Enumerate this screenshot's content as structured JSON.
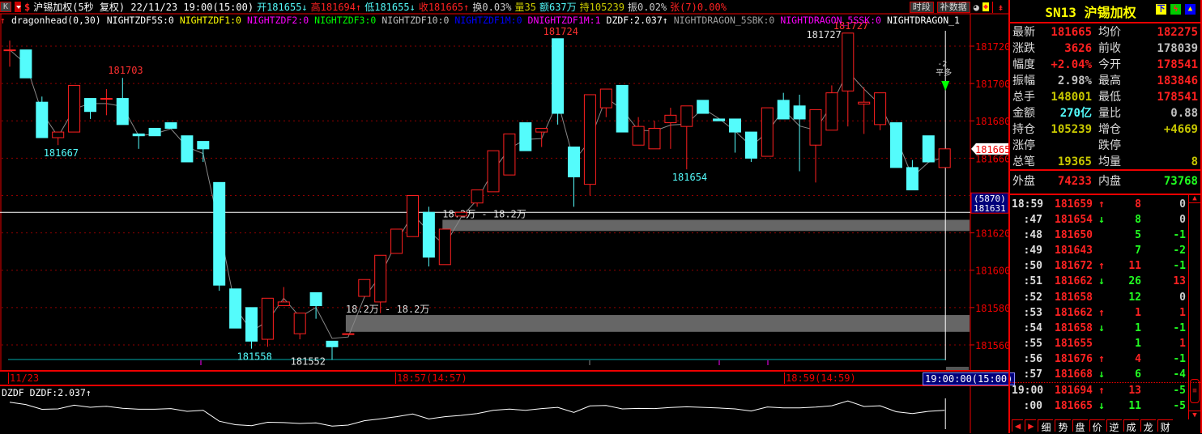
{
  "header": {
    "k_button": "K",
    "symbol_desc": "沪锡加权(5秒 复权) 22/11/23 19:00(15:00)",
    "open": "开181655↓",
    "high": "高181694↑",
    "low": "低181655↓",
    "close": "收181665↑",
    "turnover": "换0.03%",
    "volume": "量35",
    "amount": "额637万",
    "position": "持105239",
    "amplitude": "振0.02%",
    "limit": "张(7)0.00%",
    "period_button": "时段",
    "fill_data_button": "补数据"
  },
  "indicators": [
    {
      "text": "dragonhead(0,30)",
      "color": "#ffffff"
    },
    {
      "text": "NIGHTZDF5S:0",
      "color": "#ffffff"
    },
    {
      "text": "NIGHTZDF1:0",
      "color": "#ffff00"
    },
    {
      "text": "NIGHTZDF2:0",
      "color": "#ff00ff"
    },
    {
      "text": "NIGHTZDF3:0",
      "color": "#00ff00"
    },
    {
      "text": "NIGHTZDF10:0",
      "color": "#c0c0c0"
    },
    {
      "text": "NIGHTZDF1M:0",
      "color": "#0000ff"
    },
    {
      "text": "DNIGHTZDF1M:1",
      "color": "#ff00ff"
    },
    {
      "text": "DZDF:2.037↑",
      "color": "#ffffff"
    },
    {
      "text": "NIGHTDRAGON_5SBK:0",
      "color": "#a0a0a0"
    },
    {
      "text": "NIGHTDRAGON_5SSK:0",
      "color": "#ff00ff"
    },
    {
      "text": "NIGHTDRAGON_1",
      "color": "#ffffff"
    }
  ],
  "chart_data": {
    "type": "candlestick",
    "ylim": [
      181552,
      181727
    ],
    "y_ticks": [
      181720,
      181700,
      181680,
      181660,
      181620,
      181600,
      181580,
      181560
    ],
    "prev_close": 178039,
    "candles": [
      [
        181718,
        181723,
        181709,
        181718
      ],
      [
        181718,
        181718,
        181703,
        181703
      ],
      [
        181690,
        181693,
        181671,
        181671
      ],
      [
        181671,
        181674,
        181667,
        181674
      ],
      [
        181674,
        181699,
        181674,
        181699
      ],
      [
        181692,
        181692,
        181681,
        181685
      ],
      [
        181692,
        181697,
        181683,
        181692
      ],
      [
        181692,
        181703,
        181678,
        181678
      ],
      [
        181673,
        181673,
        181665,
        181672
      ],
      [
        181676,
        181676,
        181672,
        181672
      ],
      [
        181679,
        181679,
        181676,
        181676
      ],
      [
        181672,
        181672,
        181658,
        181658
      ],
      [
        181669,
        181669,
        181658,
        181665
      ],
      [
        181647,
        181647,
        181589,
        181592
      ],
      [
        181590,
        181590,
        181569,
        181569
      ],
      [
        181580,
        181580,
        181558,
        181562
      ],
      [
        181563,
        181585,
        181559,
        181585
      ],
      [
        181581,
        181591,
        181581,
        181583
      ],
      [
        181566,
        181577,
        181563,
        181577
      ],
      [
        181588,
        181588,
        181574,
        181581
      ],
      [
        181562,
        181562,
        181552,
        181559
      ],
      [
        181566,
        181566,
        181566,
        181566
      ],
      [
        181586,
        181595,
        181586,
        181595
      ],
      [
        181583,
        181608,
        181577,
        181608
      ],
      [
        181609,
        181622,
        181609,
        181622
      ],
      [
        181618,
        181640,
        181618,
        181640
      ],
      [
        181631,
        181634,
        181602,
        181607
      ],
      [
        181603,
        181622,
        181603,
        181622
      ],
      [
        181629,
        181631,
        181629,
        181631
      ],
      [
        181636,
        181643,
        181634,
        181643
      ],
      [
        181642,
        181664,
        181642,
        181664
      ],
      [
        181651,
        181673,
        181651,
        181673
      ],
      [
        181679,
        181679,
        181664,
        181664
      ],
      [
        181674,
        181676,
        181666,
        181676
      ],
      [
        181724,
        181724,
        181678,
        181684
      ],
      [
        181666,
        181666,
        181634,
        181650
      ],
      [
        181646,
        181694,
        181640,
        181694
      ],
      [
        181687,
        181697,
        181682,
        181697
      ],
      [
        181699,
        181699,
        181674,
        181674
      ],
      [
        181667,
        181682,
        181667,
        181677
      ],
      [
        181665,
        181680,
        181665,
        181676
      ],
      [
        181679,
        181687,
        181665,
        181683
      ],
      [
        181677,
        181688,
        181654,
        181688
      ],
      [
        181691,
        181691,
        181684,
        181684
      ],
      [
        181681,
        181681,
        181680,
        181680
      ],
      [
        181681,
        181681,
        181663,
        181674
      ],
      [
        181674,
        181674,
        181658,
        181660
      ],
      [
        181661,
        181687,
        181661,
        181687
      ],
      [
        181691,
        181695,
        181681,
        181681
      ],
      [
        181688,
        181694,
        181653,
        181681
      ],
      [
        181667,
        181686,
        181647,
        181686
      ],
      [
        181675,
        181699,
        181675,
        181695
      ],
      [
        181696,
        181727,
        181677,
        181727
      ],
      [
        181689,
        181698,
        181673,
        181690
      ],
      [
        181678,
        181695,
        181675,
        181695
      ],
      [
        181679,
        181679,
        181655,
        181655
      ],
      [
        181655,
        181659,
        181643,
        181643
      ],
      [
        181672,
        181672,
        181658,
        181658
      ],
      [
        181655,
        181665,
        181655,
        181665
      ]
    ],
    "annotations": [
      {
        "text": "181703",
        "price": 181703,
        "index": 7,
        "color": "#ff3030",
        "pos": "above"
      },
      {
        "text": "181667",
        "price": 181667,
        "index": 3,
        "color": "#54fcfc",
        "pos": "below"
      },
      {
        "text": "181558",
        "price": 181558,
        "index": 15,
        "color": "#54fcfc",
        "pos": "below"
      },
      {
        "text": "181552",
        "price": 181552,
        "index": 20,
        "color": "#e0e0e0",
        "pos": "left"
      },
      {
        "text": "181724",
        "price": 181724,
        "index": 34,
        "color": "#ff3030",
        "pos": "above"
      },
      {
        "text": "181654",
        "price": 181654,
        "index": 42,
        "color": "#54fcfc",
        "pos": "below"
      },
      {
        "text": "181727",
        "price": 181727,
        "index": 52,
        "color": "#e0e0e0",
        "pos": "left"
      },
      {
        "text": "181727",
        "price": 181727,
        "index": 52,
        "color": "#ff3030",
        "pos": "above"
      }
    ],
    "volume_zones": [
      {
        "label": "18.2万 - 18.2万",
        "from": 181621,
        "to": 181627,
        "start_index": 27
      },
      {
        "label": "18.2万 - 18.2万",
        "from": 181567,
        "to": 181576,
        "start_index": 21
      }
    ],
    "crosshair_price": 181631,
    "crosshair_tag_count": "(5870)",
    "crosshair_tag_price": "181631",
    "last_price_tag": "181665",
    "signal": {
      "text1": "-2",
      "text2": "平多"
    },
    "lower_title": "DZDF DZDF:2.037↑"
  },
  "time_axis": {
    "date": "11/23",
    "t1": "18:57(14:57)",
    "t2": "18:59(14:59)",
    "cursor": "19:00:00(15:00)"
  },
  "quote": {
    "title": "SN13 沪锡加权",
    "rows": [
      {
        "l1": "最新",
        "v1": "181665",
        "c1": "#ff2020",
        "l2": "均价",
        "v2": "182275",
        "c2": "#ff2020"
      },
      {
        "l1": "涨跌",
        "v1": "3626",
        "c1": "#ff2020",
        "l2": "前收",
        "v2": "178039",
        "c2": "#c0c0c0"
      },
      {
        "l1": "幅度",
        "v1": "+2.04%",
        "c1": "#ff2020",
        "l2": "今开",
        "v2": "178541",
        "c2": "#ff2020"
      },
      {
        "l1": "振幅",
        "v1": "2.98%",
        "c1": "#c0c0c0",
        "l2": "最高",
        "v2": "183846",
        "c2": "#ff2020"
      },
      {
        "l1": "总手",
        "v1": "148001",
        "c1": "#c8c800",
        "l2": "最低",
        "v2": "178541",
        "c2": "#ff2020"
      },
      {
        "l1": "金额",
        "v1": "270亿",
        "c1": "#54fcfc",
        "l2": "量比",
        "v2": "0.88",
        "c2": "#c0c0c0"
      },
      {
        "l1": "持仓",
        "v1": "105239",
        "c1": "#c8c800",
        "l2": "增仓",
        "v2": "+4669",
        "c2": "#c8c800"
      },
      {
        "l1": "涨停",
        "v1": "",
        "c1": "#fff",
        "l2": "跌停",
        "v2": "",
        "c2": "#fff"
      },
      {
        "l1": "总笔",
        "v1": "19365",
        "c1": "#c8c800",
        "l2": "均量",
        "v2": "8",
        "c2": "#c8c800"
      }
    ],
    "outer": {
      "l1": "外盘",
      "v1": "74233",
      "c1": "#ff2020",
      "l2": "内盘",
      "v2": "73768",
      "c2": "#20ff20"
    }
  },
  "ticks": [
    {
      "t": "18:59",
      "p": "181659",
      "d": "up",
      "v": "8",
      "oi": "0"
    },
    {
      "t": ":47",
      "p": "181654",
      "d": "down",
      "v": "8",
      "oi": "0"
    },
    {
      "t": ":48",
      "p": "181650",
      "d": "",
      "v": "5",
      "oi": "-1"
    },
    {
      "t": ":49",
      "p": "181643",
      "d": "",
      "v": "7",
      "oi": "-2"
    },
    {
      "t": ":50",
      "p": "181672",
      "d": "up",
      "v": "11",
      "oi": "-1"
    },
    {
      "t": ":51",
      "p": "181662",
      "d": "down",
      "v": "26",
      "oi": "13"
    },
    {
      "t": ":52",
      "p": "181658",
      "d": "",
      "v": "12",
      "oi": "0"
    },
    {
      "t": ":53",
      "p": "181662",
      "d": "up",
      "v": "1",
      "oi": "1"
    },
    {
      "t": ":54",
      "p": "181658",
      "d": "down",
      "v": "1",
      "oi": "-1"
    },
    {
      "t": ":55",
      "p": "181655",
      "d": "",
      "v": "1",
      "oi": "1"
    },
    {
      "t": ":56",
      "p": "181676",
      "d": "up",
      "v": "4",
      "oi": "-1"
    },
    {
      "t": ":57",
      "p": "181668",
      "d": "down",
      "v": "6",
      "oi": "-4"
    },
    {
      "t": "19:00",
      "p": "181694",
      "d": "up",
      "v": "13",
      "oi": "-5"
    },
    {
      "t": ":00",
      "p": "181665",
      "d": "down",
      "v": "11",
      "oi": "-5"
    }
  ],
  "bottom_tabs": [
    "细",
    "势",
    "盘",
    "价",
    "逆",
    "成",
    "龙",
    "财"
  ],
  "colors": {
    "up": "#ff2020",
    "down": "#54fcfc",
    "grid": "#900000",
    "zone": "#666666"
  }
}
